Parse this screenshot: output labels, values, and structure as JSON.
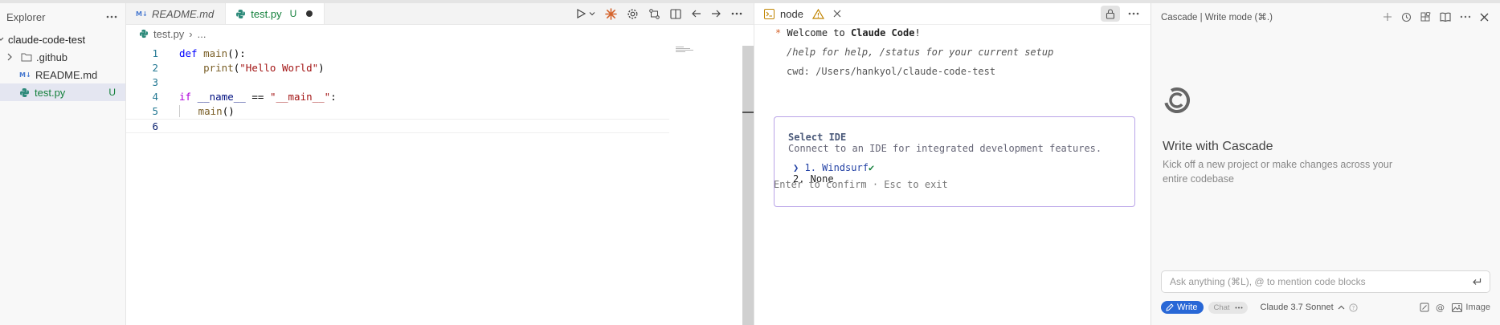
{
  "explorer": {
    "title": "Explorer",
    "root": "claude-code-test",
    "items": [
      {
        "label": ".github",
        "type": "folder"
      },
      {
        "label": "README.md",
        "type": "markdown"
      },
      {
        "label": "test.py",
        "type": "python",
        "badge": "U",
        "selected": true
      }
    ]
  },
  "editor": {
    "tabs": [
      {
        "label": "README.md",
        "type": "markdown"
      },
      {
        "label": "test.py",
        "type": "python",
        "badge": "U",
        "active": true,
        "dirty": true
      }
    ],
    "breadcrumb": [
      "test.py",
      "..."
    ],
    "line_numbers": [
      "1",
      "2",
      "3",
      "4",
      "5",
      "6"
    ],
    "code": {
      "l1_def": "def",
      "l1_main": "main",
      "l1_rest": "():",
      "l2_print": "print",
      "l2_open": "(",
      "l2_str": "\"Hello World\"",
      "l2_close": ")",
      "l4_if": "if",
      "l4_name": "__name__",
      "l4_eq": "==",
      "l4_str": "\"__main__\"",
      "l4_colon": ":",
      "l5_main": "main",
      "l5_rest": "()"
    }
  },
  "terminal": {
    "tab_label": "node",
    "welcome_prefix": "Welcome to ",
    "welcome_bold": "Claude Code",
    "welcome_suffix": "!",
    "help_line": "/help for help, /status for your current setup",
    "cwd_line": "cwd: /Users/hankyol/claude-code-test",
    "ide_title": "Select IDE",
    "ide_subtitle": "Connect to an IDE for integrated development features.",
    "option1": "1. Windsurf",
    "option2": "2. None",
    "hint": "Enter to confirm · Esc to exit"
  },
  "cascade": {
    "header": "Cascade | Write mode (⌘.)",
    "title": "Write with Cascade",
    "subtitle": "Kick off a new project or make changes across your entire codebase",
    "input_placeholder": "Ask anything (⌘L), @ to mention code blocks",
    "write_label": "Write",
    "chat_label": "Chat",
    "model": "Claude 3.7 Sonnet",
    "image_label": "Image"
  },
  "colors": {
    "accent_green": "#14803c",
    "claude_orange": "#d4622a",
    "cascade_blue": "#2867d6",
    "selection_border": "#b9a4e8"
  }
}
